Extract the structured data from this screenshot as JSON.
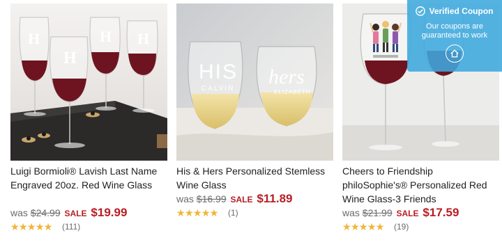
{
  "products": [
    {
      "title": "Luigi Bormioli® Lavish Last Name Engraved 20oz. Red Wine Glass",
      "was_label": "was",
      "was_price": "$24.99",
      "sale_label": "SALE",
      "sale_price": "$19.99",
      "rating": 5,
      "review_count": "(111)",
      "image_alt": "Engraved red wine glasses on a slate board"
    },
    {
      "title": "His & Hers Personalized Stemless Wine Glass",
      "was_label": "was",
      "was_price": "$16.99",
      "sale_label": "SALE",
      "sale_price": "$11.89",
      "rating": 5,
      "review_count": "(1)",
      "image_alt": "Two stemless wine glasses engraved HIS and hers"
    },
    {
      "title": "Cheers to Friendship philoSophie's® Personalized Red Wine Glass-3 Friends",
      "was_label": "was",
      "was_price": "$21.99",
      "sale_label": "SALE",
      "sale_price": "$17.59",
      "rating": 4.5,
      "review_count": "(19)",
      "image_alt": "Red wine glass printed with three friends cheering"
    }
  ],
  "coupon": {
    "title": "Verified Coupon",
    "message": "Our coupons are guaranteed to work",
    "icon": "home-icon"
  },
  "stars_glyphs": "★★★★★",
  "colors": {
    "sale": "#b81d24",
    "star": "#f2b632",
    "coupon_bg": "#3ea8de"
  }
}
